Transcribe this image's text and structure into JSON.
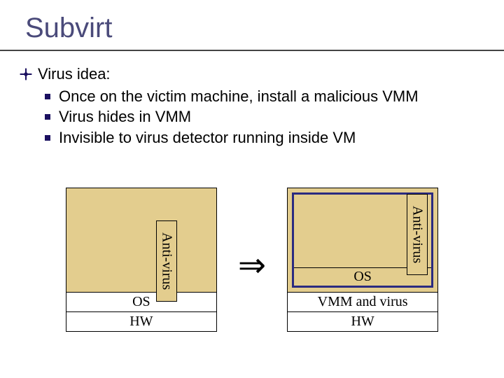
{
  "title": "Subvirt",
  "bullets": {
    "b1": "Virus idea:",
    "sub": [
      "Once on the victim machine, install a malicious VMM",
      "Virus hides in VMM",
      "Invisible to virus detector running inside VM"
    ]
  },
  "diagram": {
    "left": {
      "antivirus": "Anti-virus",
      "os": "OS",
      "hw": "HW"
    },
    "arrow": "⇒",
    "right": {
      "antivirus": "Anti-virus",
      "inner_os": "OS",
      "vmm": "VMM and virus",
      "hw": "HW"
    }
  }
}
